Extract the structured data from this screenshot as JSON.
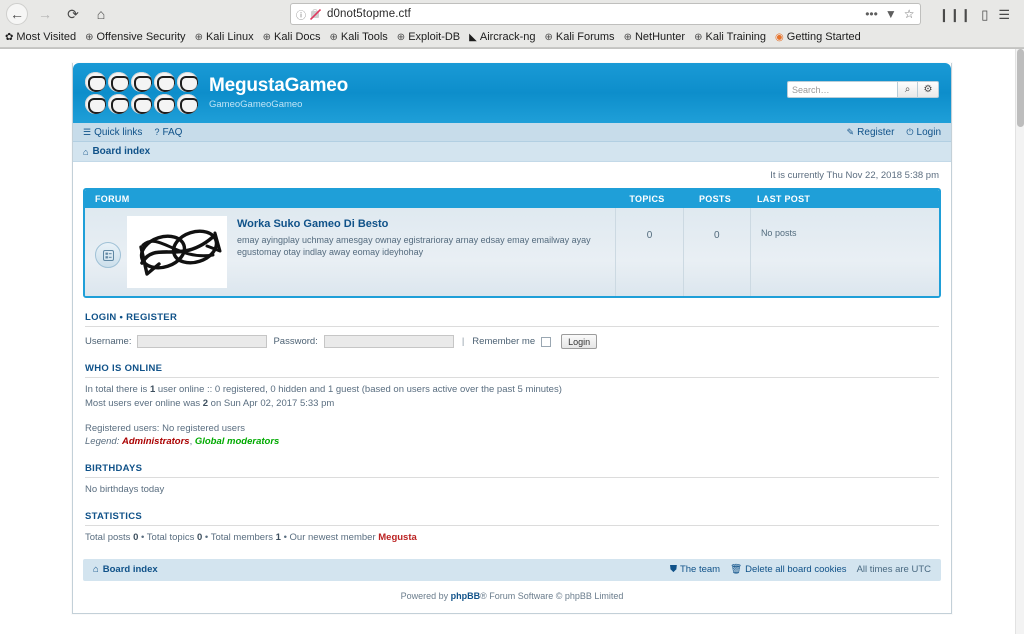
{
  "browser": {
    "back_icon": "←",
    "forward_icon": "→",
    "reload_icon": "⟳",
    "home_icon": "⌂",
    "url": "d0not5topme.ctf",
    "info_icon": "ⓘ",
    "page_actions_icon": "•••",
    "pocket_icon": "▼",
    "bookmark_star_icon": "☆",
    "library_icon": "❙❙❙",
    "sidebar_icon": "▯",
    "menu_icon": "☰",
    "bookmarks": [
      {
        "label": "Most Visited",
        "icon": "✿"
      },
      {
        "label": "Offensive Security",
        "icon": "⊕"
      },
      {
        "label": "Kali Linux",
        "icon": "⊕"
      },
      {
        "label": "Kali Docs",
        "icon": "⊕"
      },
      {
        "label": "Kali Tools",
        "icon": "⊕"
      },
      {
        "label": "Exploit-DB",
        "icon": "⊕"
      },
      {
        "label": "Aircrack-ng",
        "icon": "◣"
      },
      {
        "label": "Kali Forums",
        "icon": "⊕"
      },
      {
        "label": "NetHunter",
        "icon": "⊕"
      },
      {
        "label": "Kali Training",
        "icon": "⊕"
      },
      {
        "label": "Getting Started",
        "icon": "◉"
      }
    ]
  },
  "site": {
    "title": "MegustaGameo",
    "description": "GameoGameoGameo",
    "logo_icon": "megusta-face-icon",
    "logo_count": 10
  },
  "search": {
    "placeholder": "Search…",
    "search_icon": "⌕",
    "options_icon": "⚙"
  },
  "navbar": {
    "quick_links": "Quick links",
    "quick_links_icon": "☰",
    "faq": "FAQ",
    "faq_icon": "?",
    "register": "Register",
    "register_icon": "✎",
    "login": "Login",
    "login_icon": "⏻"
  },
  "breadcrumb": {
    "home_icon": "⌂",
    "board_index": "Board index"
  },
  "current_time": "It is currently Thu Nov 22, 2018 5:38 pm",
  "forum_table": {
    "headers": {
      "forum": "FORUM",
      "topics": "TOPICS",
      "posts": "POSTS",
      "last_post": "LAST POST"
    },
    "rows": [
      {
        "title": "Worka Suko Gameo Di Besto",
        "description": "emay ayingplay uchmay amesgay ownay egistrarioray arnay edsay emay emailway ayay egustomay otay indlay away eomay ideyhohay",
        "topics": "0",
        "posts": "0",
        "last_post": "No posts",
        "icon": "forum-unread-icon",
        "thumb": "scribble-doodle-image"
      }
    ]
  },
  "login_section": {
    "title_login": "LOGIN",
    "title_sep": "•",
    "title_register": "REGISTER",
    "username_label": "Username:",
    "username_value": "",
    "password_label": "Password:",
    "password_value": "",
    "pipe": "|",
    "remember_label": "Remember me",
    "login_button": "Login"
  },
  "who_is_online": {
    "title": "WHO IS ONLINE",
    "line1_a": "In total there is ",
    "line1_count": "1",
    "line1_b": " user online :: 0 registered, 0 hidden and 1 guest (based on users active over the past 5 minutes)",
    "line2_a": "Most users ever online was ",
    "line2_count": "2",
    "line2_b": " on Sun Apr 02, 2017 5:33 pm",
    "registered_users": "Registered users: No registered users",
    "legend_label": "Legend:",
    "legend_admins": "Administrators",
    "legend_comma": ",",
    "legend_mods": "Global moderators"
  },
  "birthdays": {
    "title": "BIRTHDAYS",
    "body": "No birthdays today"
  },
  "statistics": {
    "title": "STATISTICS",
    "total_posts_label": "Total posts ",
    "total_posts": "0",
    "sep1": " • ",
    "total_topics_label": "Total topics ",
    "total_topics": "0",
    "sep2": " • ",
    "total_members_label": "Total members ",
    "total_members": "1",
    "sep3": " • ",
    "newest_label": "Our newest member ",
    "newest_member": "Megusta"
  },
  "footer": {
    "board_index": "Board index",
    "home_icon": "⌂",
    "the_team": "The team",
    "the_team_icon": "⛊",
    "delete_cookies": "Delete all board cookies",
    "delete_cookies_icon": "🗑",
    "timezone": "All times are UTC",
    "powered_prefix": "Powered by ",
    "phpbb": "phpBB",
    "powered_suffix": "® Forum Software © phpBB Limited"
  }
}
